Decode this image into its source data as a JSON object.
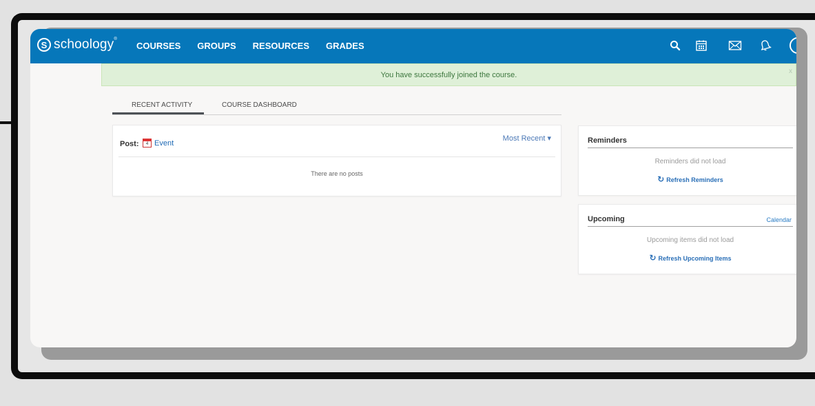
{
  "app": {
    "logo_mark": "S",
    "logo_text": "schoology",
    "logo_tm": "®"
  },
  "nav": {
    "items": [
      {
        "label": "COURSES"
      },
      {
        "label": "GROUPS"
      },
      {
        "label": "RESOURCES"
      },
      {
        "label": "GRADES"
      }
    ],
    "icons": [
      "search-icon",
      "calendar-icon",
      "mail-icon",
      "notifications-icon",
      "user-avatar"
    ]
  },
  "banner": {
    "message": "You have successfully joined the course.",
    "close": "x"
  },
  "tabs": [
    {
      "label": "RECENT ACTIVITY",
      "active": true
    },
    {
      "label": "COURSE DASHBOARD",
      "active": false
    }
  ],
  "post": {
    "label": "Post:",
    "event_day": "4",
    "event_label": "Event",
    "sort_label": "Most Recent ▾",
    "empty_text": "There are no posts"
  },
  "reminders": {
    "title": "Reminders",
    "message": "Reminders did not load",
    "refresh_label": "Refresh Reminders"
  },
  "upcoming": {
    "title": "Upcoming",
    "calendar_link": "Calendar",
    "message": "Upcoming items did not load",
    "refresh_label": "Refresh Upcoming Items"
  },
  "colors": {
    "nav": "#0677ba",
    "banner_bg": "#dff0d8",
    "link": "#2a6fb7"
  }
}
